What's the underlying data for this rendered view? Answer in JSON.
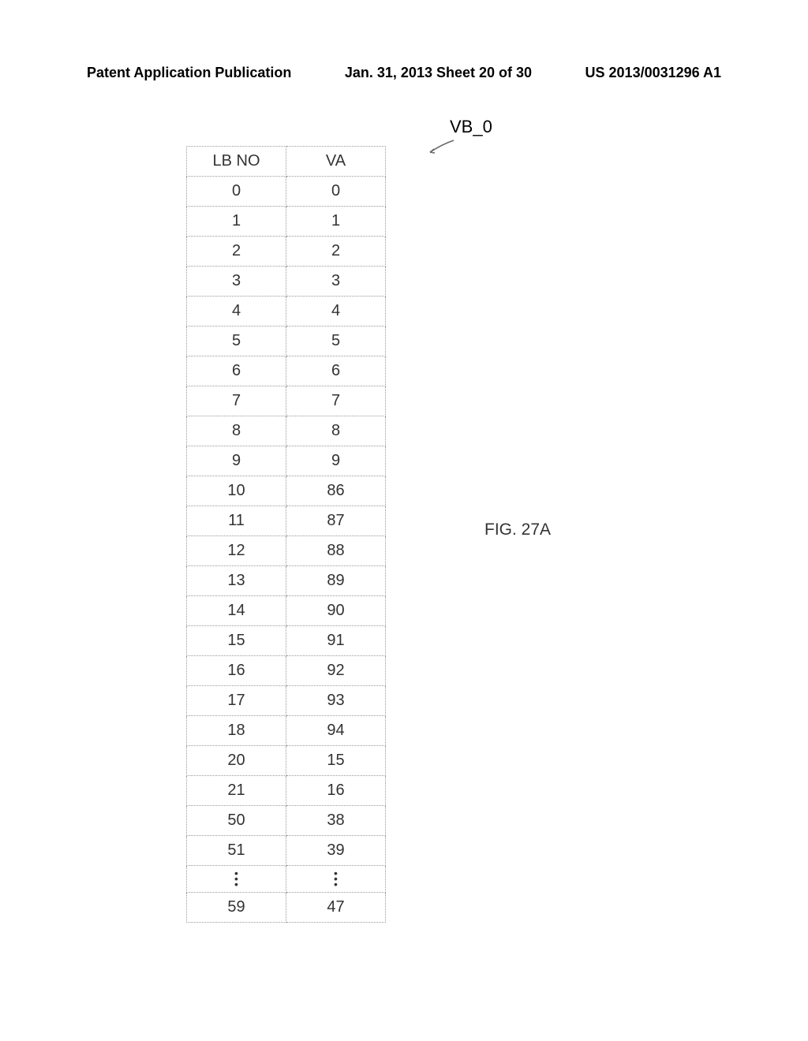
{
  "header": {
    "left": "Patent Application Publication",
    "center": "Jan. 31, 2013  Sheet 20 of 30",
    "right": "US 2013/0031296 A1"
  },
  "vb_label": "VB_0",
  "fig_label": "FIG. 27A",
  "chart_data": {
    "type": "table",
    "title": "VB_0",
    "columns": [
      "LB NO",
      "VA"
    ],
    "rows": [
      [
        "0",
        "0"
      ],
      [
        "1",
        "1"
      ],
      [
        "2",
        "2"
      ],
      [
        "3",
        "3"
      ],
      [
        "4",
        "4"
      ],
      [
        "5",
        "5"
      ],
      [
        "6",
        "6"
      ],
      [
        "7",
        "7"
      ],
      [
        "8",
        "8"
      ],
      [
        "9",
        "9"
      ],
      [
        "10",
        "86"
      ],
      [
        "11",
        "87"
      ],
      [
        "12",
        "88"
      ],
      [
        "13",
        "89"
      ],
      [
        "14",
        "90"
      ],
      [
        "15",
        "91"
      ],
      [
        "16",
        "92"
      ],
      [
        "17",
        "93"
      ],
      [
        "18",
        "94"
      ],
      [
        "20",
        "15"
      ],
      [
        "21",
        "16"
      ],
      [
        "50",
        "38"
      ],
      [
        "51",
        "39"
      ],
      [
        "⋮",
        "⋮"
      ],
      [
        "59",
        "47"
      ]
    ]
  }
}
